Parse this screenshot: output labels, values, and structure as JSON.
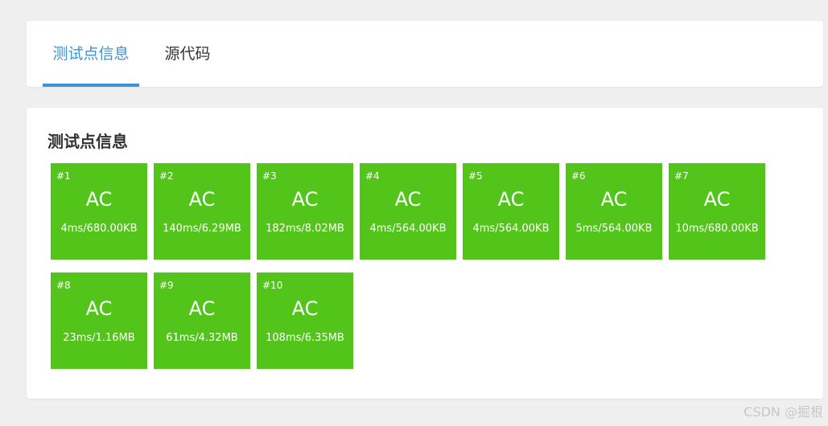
{
  "tabs": {
    "items": [
      {
        "label": "测试点信息",
        "active": true
      },
      {
        "label": "源代码",
        "active": false
      }
    ],
    "active_color": "#3c93d8"
  },
  "test_info": {
    "title": "测试点信息",
    "status_color": "#52c41a",
    "cases": [
      {
        "id": "#1",
        "status": "AC",
        "stats": "4ms/680.00KB"
      },
      {
        "id": "#2",
        "status": "AC",
        "stats": "140ms/6.29MB"
      },
      {
        "id": "#3",
        "status": "AC",
        "stats": "182ms/8.02MB"
      },
      {
        "id": "#4",
        "status": "AC",
        "stats": "4ms/564.00KB"
      },
      {
        "id": "#5",
        "status": "AC",
        "stats": "4ms/564.00KB"
      },
      {
        "id": "#6",
        "status": "AC",
        "stats": "5ms/564.00KB"
      },
      {
        "id": "#7",
        "status": "AC",
        "stats": "10ms/680.00KB"
      },
      {
        "id": "#8",
        "status": "AC",
        "stats": "23ms/1.16MB"
      },
      {
        "id": "#9",
        "status": "AC",
        "stats": "61ms/4.32MB"
      },
      {
        "id": "#10",
        "status": "AC",
        "stats": "108ms/6.35MB"
      }
    ]
  },
  "watermark": "CSDN @掘根"
}
